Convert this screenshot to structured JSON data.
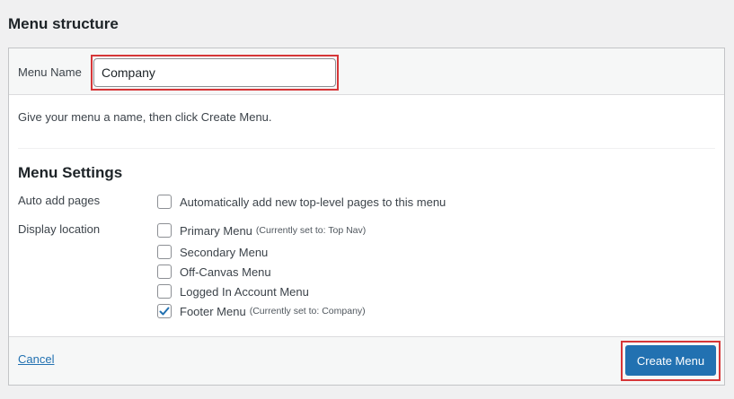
{
  "page": {
    "title": "Menu structure"
  },
  "menu_name": {
    "label": "Menu Name",
    "value": "Company"
  },
  "instructions": "Give your menu a name, then click Create Menu.",
  "settings": {
    "title": "Menu Settings",
    "auto_add": {
      "label": "Auto add pages",
      "option_label": "Automatically add new top-level pages to this menu",
      "checked": false
    },
    "display_location": {
      "label": "Display location",
      "options": [
        {
          "label": "Primary Menu",
          "note": "(Currently set to: Top Nav)",
          "checked": false
        },
        {
          "label": "Secondary Menu",
          "note": "",
          "checked": false
        },
        {
          "label": "Off-Canvas Menu",
          "note": "",
          "checked": false
        },
        {
          "label": "Logged In Account Menu",
          "note": "",
          "checked": false
        },
        {
          "label": "Footer Menu",
          "note": "(Currently set to: Company)",
          "checked": true
        }
      ]
    }
  },
  "footer": {
    "cancel_label": "Cancel",
    "create_label": "Create Menu"
  },
  "colors": {
    "accent": "#2271b1",
    "highlight": "#d63638"
  }
}
